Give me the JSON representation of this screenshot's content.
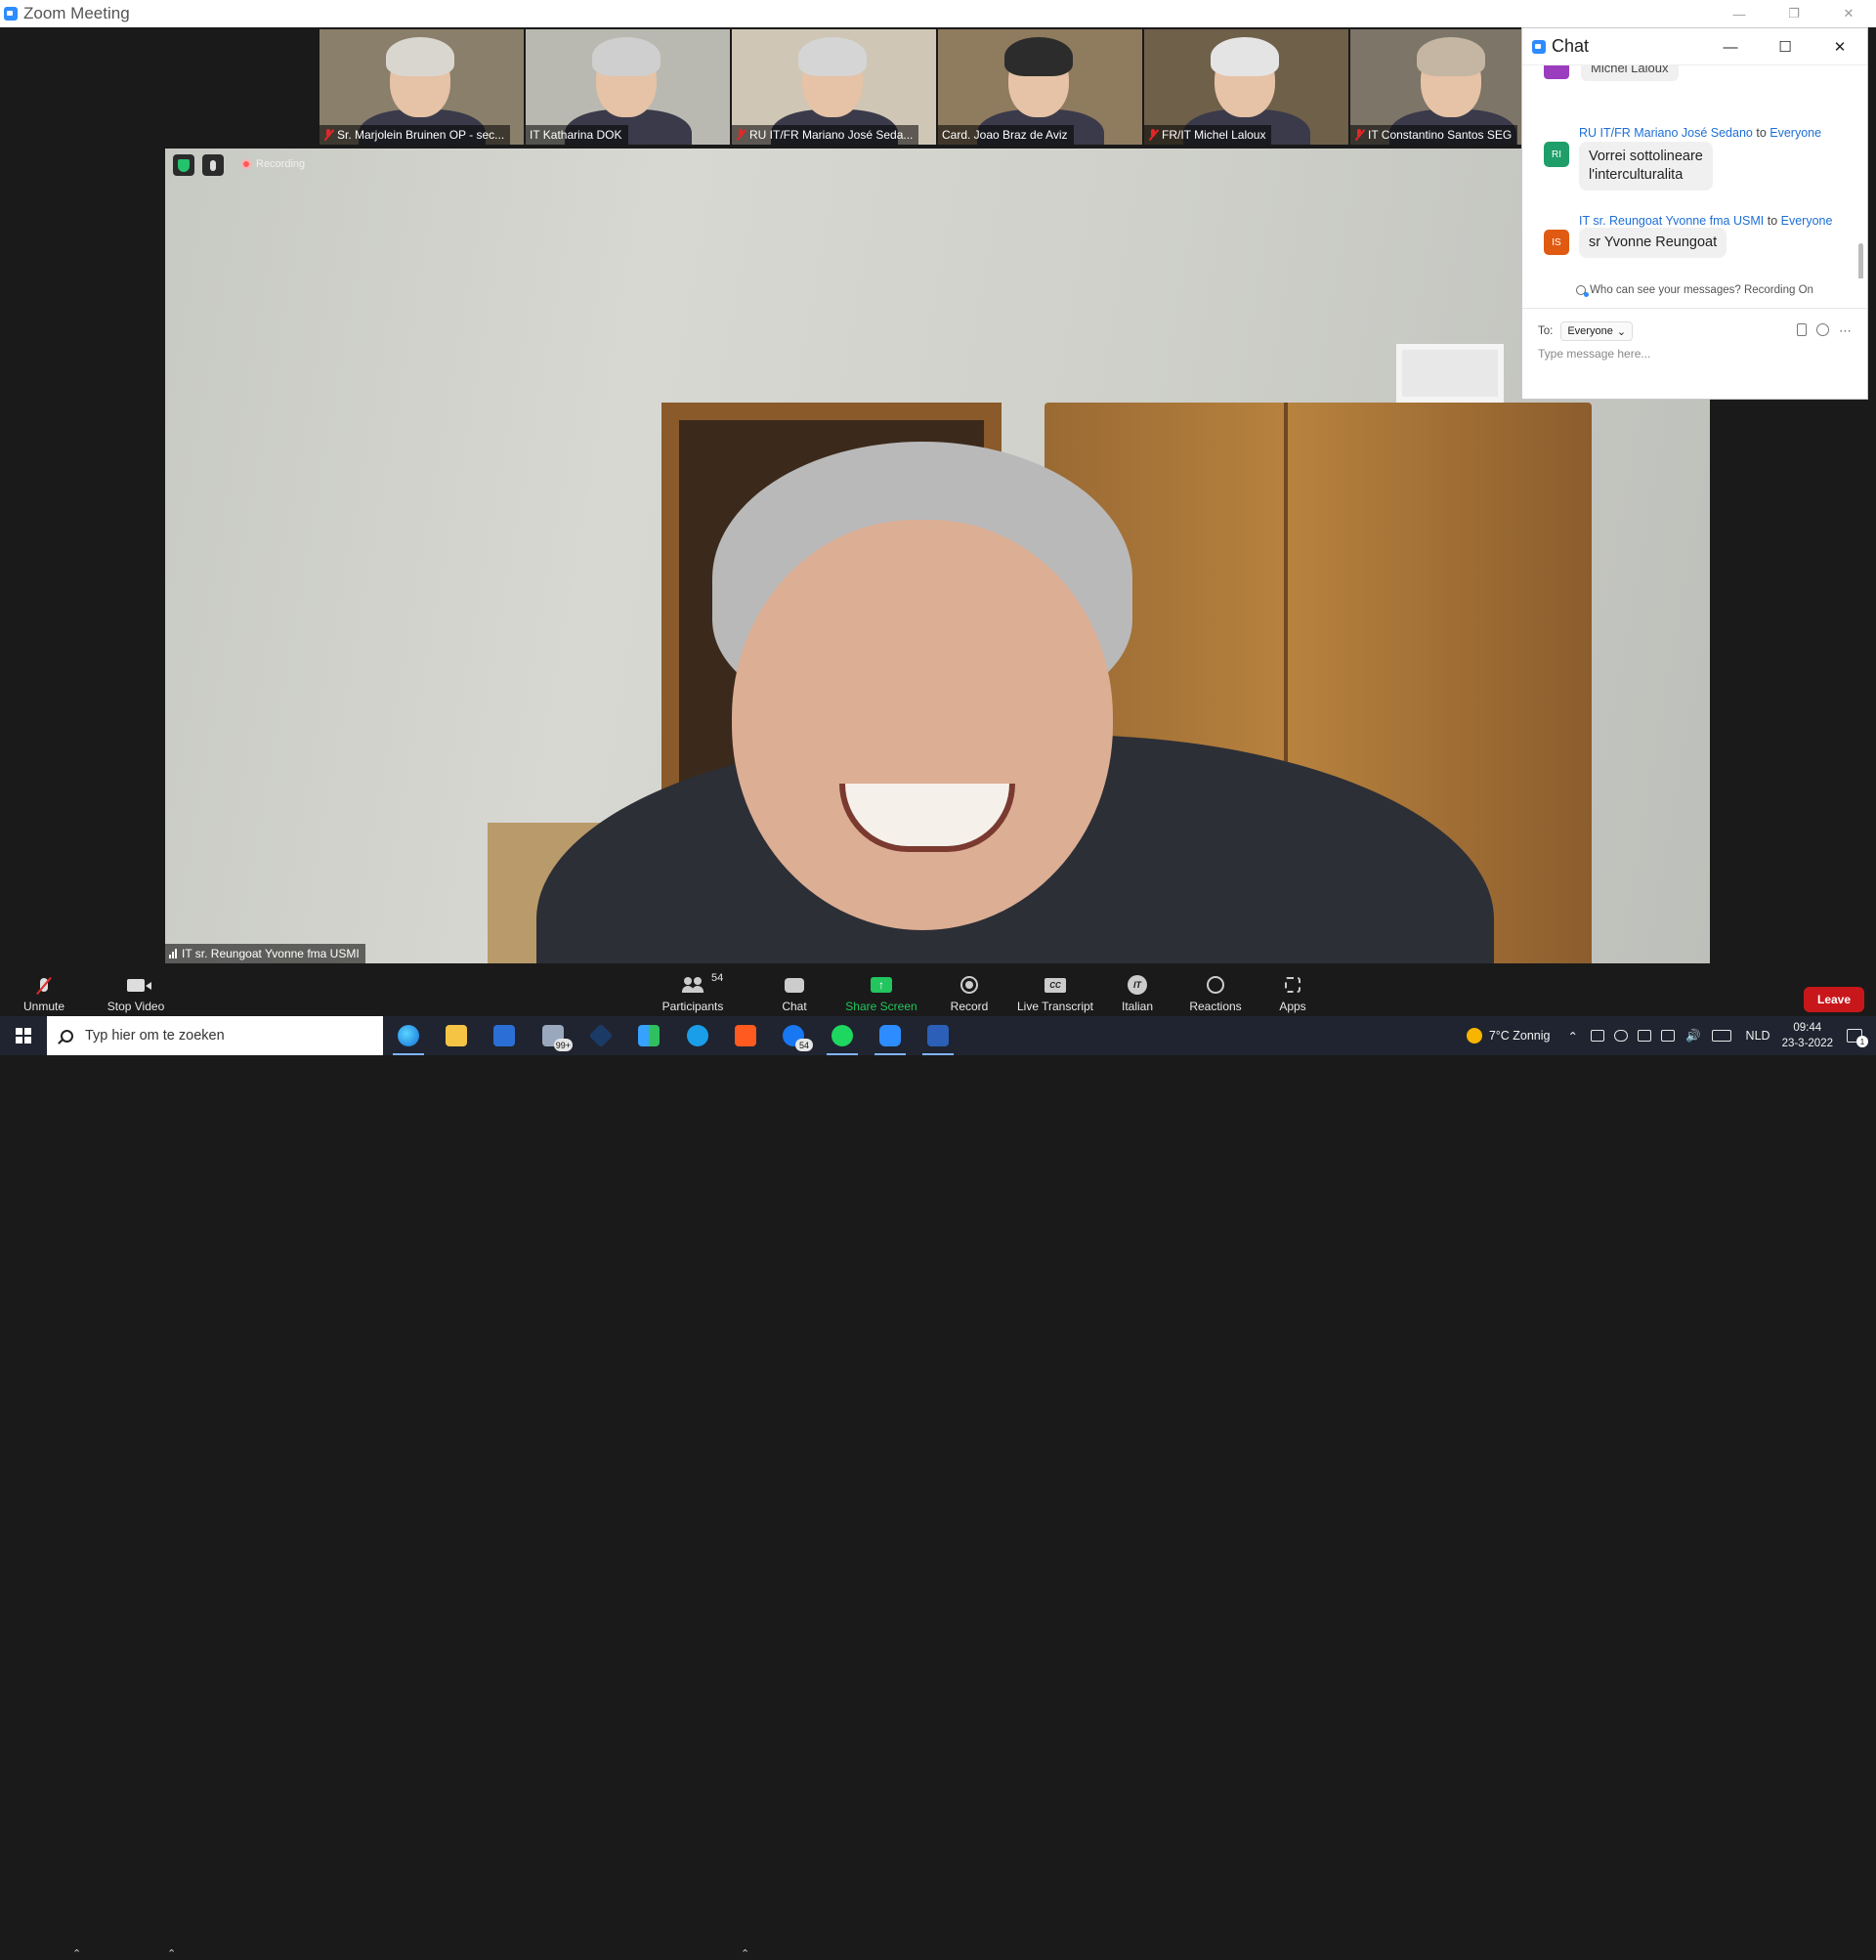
{
  "window": {
    "title": "Zoom Meeting"
  },
  "security": {
    "recording_label": "Recording"
  },
  "gallery": [
    {
      "name": "Sr. Marjolein Bruinen OP - sec...",
      "muted": true,
      "hair": "#d9d6d0",
      "bg": "#8a7f6a"
    },
    {
      "name": "IT Katharina DOK",
      "muted": false,
      "hair": "#cfcfcf",
      "bg": "#b9b9b2"
    },
    {
      "name": "RU  IT/FR Mariano José Seda...",
      "muted": true,
      "hair": "#d5d5d5",
      "bg": "#cfc6b5"
    },
    {
      "name": "Card. Joao Braz de Aviz",
      "muted": false,
      "hair": "#2c2c2c",
      "bg": "#8f7b5e"
    },
    {
      "name": "FR/IT Michel Laloux",
      "muted": true,
      "hair": "#e4e4e4",
      "bg": "#6f6049"
    },
    {
      "name": "IT Constantino Santos SEG",
      "muted": true,
      "hair": "#c4b6a2",
      "bg": "#7d7567"
    }
  ],
  "speaker": {
    "name": "IT sr. Reungoat Yvonne fma USMI"
  },
  "chat": {
    "title": "Chat",
    "previous_message": "Michel Laloux",
    "messages": [
      {
        "from": "RU  IT/FR Mariano José Sedano",
        "to_word": "to",
        "to": "Everyone",
        "initials": "RI",
        "avatar_color": "#1f9e6a",
        "text_lines": [
          "Vorrei sottolineare",
          "l'interculturalita"
        ]
      },
      {
        "from": "IT sr. Reungoat Yvonne fma USMI",
        "to_word": "to",
        "to": "Everyone",
        "initials": "IS",
        "avatar_color": "#e05a12",
        "text_lines": [
          "sr Yvonne Reungoat"
        ]
      }
    ],
    "visibility_note": "Who can see your messages? Recording On",
    "to_label": "To:",
    "recipient": "Everyone",
    "input_placeholder": "Type message here..."
  },
  "toolbar": {
    "unmute": "Unmute",
    "stop_video": "Stop Video",
    "participants": "Participants",
    "participant_count": "54",
    "chat": "Chat",
    "share_screen": "Share Screen",
    "record": "Record",
    "live_transcript": "Live Transcript",
    "cc_glyph": "CC",
    "interpretation": "Italian",
    "interpretation_glyph": "IT",
    "reactions": "Reactions",
    "apps": "Apps",
    "leave": "Leave",
    "accent_green": "#22c55e",
    "leave_red": "#c8171b"
  },
  "taskbar": {
    "search_placeholder": "Typ hier om te zoeken",
    "mail_badge": "99+",
    "messenger_badge": "54",
    "weather": "7°C  Zonnig",
    "language": "NLD",
    "time": "09:44",
    "date": "23-3-2022",
    "notification_count": "1"
  }
}
